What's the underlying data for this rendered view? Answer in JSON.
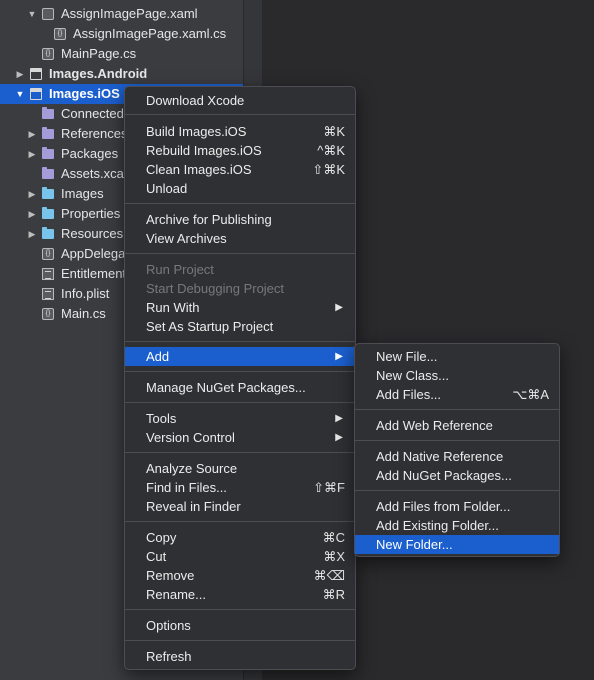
{
  "tree": {
    "items": [
      {
        "label": "AssignImagePage.xaml",
        "icon": "xaml-file-icon",
        "expanded": true,
        "bold": false
      },
      {
        "label": "AssignImagePage.xaml.cs",
        "icon": "code-file-icon",
        "bold": false
      },
      {
        "label": "MainPage.cs",
        "icon": "code-file-icon",
        "bold": false
      },
      {
        "label": "Images.Android",
        "icon": "project-icon",
        "expanded": false,
        "bold": true
      },
      {
        "label": "Images.iOS",
        "icon": "project-icon",
        "expanded": true,
        "bold": true,
        "selected": true
      },
      {
        "label": "Connected",
        "icon": "connected-services-icon"
      },
      {
        "label": "References",
        "icon": "references-folder-icon",
        "expanded": false
      },
      {
        "label": "Packages",
        "icon": "packages-folder-icon",
        "expanded": false
      },
      {
        "label": "Assets.xca",
        "icon": "assets-icon"
      },
      {
        "label": "Images",
        "icon": "folder-icon",
        "expanded": false
      },
      {
        "label": "Properties",
        "icon": "folder-icon",
        "expanded": false
      },
      {
        "label": "Resources",
        "icon": "folder-icon",
        "expanded": false
      },
      {
        "label": "AppDelega",
        "icon": "code-file-icon"
      },
      {
        "label": "Entitlement",
        "icon": "plist-file-icon"
      },
      {
        "label": "Info.plist",
        "icon": "plist-file-icon"
      },
      {
        "label": "Main.cs",
        "icon": "code-file-icon"
      }
    ],
    "code_glyph": "{}",
    "expanded_glyph": "▼",
    "collapsed_glyph": "▶"
  },
  "context_menu": {
    "download_xcode": "Download Xcode",
    "build": "Build Images.iOS",
    "build_shortcut": "⌘K",
    "rebuild": "Rebuild Images.iOS",
    "rebuild_shortcut": "^⌘K",
    "clean": "Clean Images.iOS",
    "clean_shortcut": "⇧⌘K",
    "unload": "Unload",
    "archive": "Archive for Publishing",
    "view_archives": "View Archives",
    "run_project": "Run Project",
    "start_debugging": "Start Debugging Project",
    "run_with": "Run With",
    "set_startup": "Set As Startup Project",
    "add": "Add",
    "manage_nuget": "Manage NuGet Packages...",
    "tools": "Tools",
    "version_control": "Version Control",
    "analyze_source": "Analyze Source",
    "find_in_files": "Find in Files...",
    "find_shortcut": "⇧⌘F",
    "reveal_in_finder": "Reveal in Finder",
    "copy": "Copy",
    "copy_shortcut": "⌘C",
    "cut": "Cut",
    "cut_shortcut": "⌘X",
    "remove": "Remove",
    "remove_shortcut": "⌘⌫",
    "rename": "Rename...",
    "rename_shortcut": "⌘R",
    "options": "Options",
    "refresh": "Refresh",
    "submenu_glyph": "▶"
  },
  "add_submenu": {
    "new_file": "New File...",
    "new_class": "New Class...",
    "add_files": "Add Files...",
    "add_files_shortcut": "⌥⌘A",
    "add_web_reference": "Add Web Reference",
    "add_native_reference": "Add Native Reference",
    "add_nuget_packages": "Add NuGet Packages...",
    "add_files_from_folder": "Add Files from Folder...",
    "add_existing_folder": "Add Existing Folder...",
    "new_folder": "New Folder..."
  },
  "colors": {
    "selection": "#1b5fce",
    "menu_bg": "#2f3034",
    "tree_bg": "#3b3c40",
    "folder": "#79c4ea"
  }
}
